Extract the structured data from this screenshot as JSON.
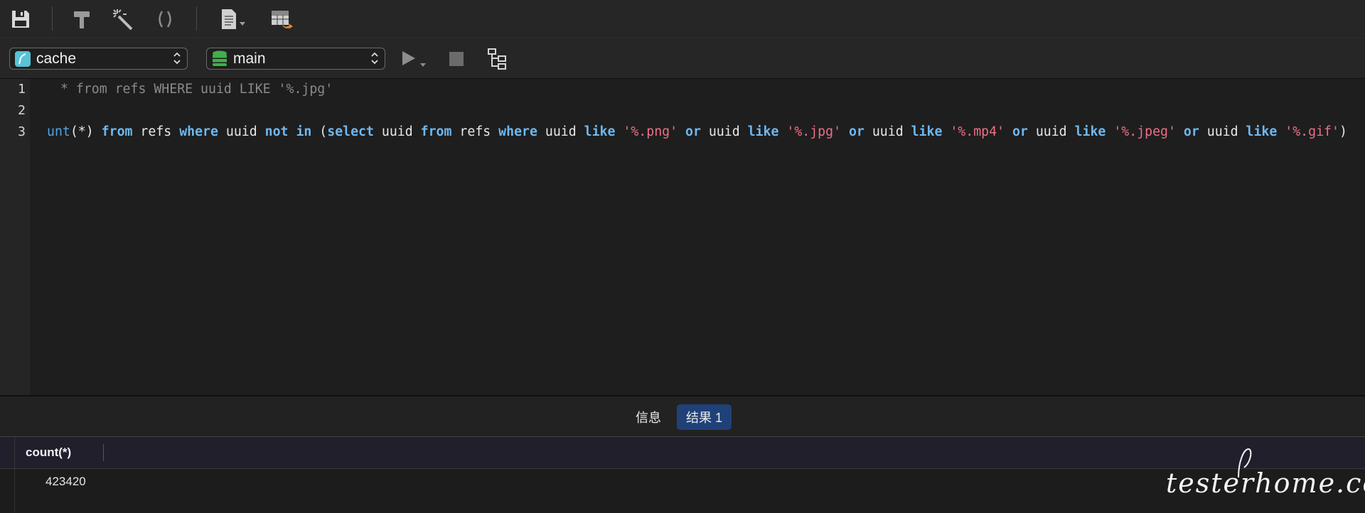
{
  "toolbar": {
    "icons": [
      "save-icon",
      "hammer-icon",
      "magic-wand-icon",
      "parentheses-icon",
      "document-icon",
      "table-export-icon"
    ]
  },
  "selectors": {
    "database": "cache",
    "schema": "main"
  },
  "editor": {
    "line_numbers": [
      "1",
      "2",
      "3"
    ],
    "line1": " * from refs WHERE uuid LIKE '%.jpg'"
  },
  "results": {
    "tabs": [
      {
        "label": "信息",
        "active": false
      },
      {
        "label": "结果 1",
        "active": true
      }
    ],
    "columns": [
      "count(*)"
    ],
    "rows": [
      [
        "423420"
      ]
    ]
  },
  "watermark": "testerhome.com",
  "colors": {
    "keyword": "#6fb8f0",
    "string": "#ee6f88",
    "active_tab": "#1f4178"
  }
}
